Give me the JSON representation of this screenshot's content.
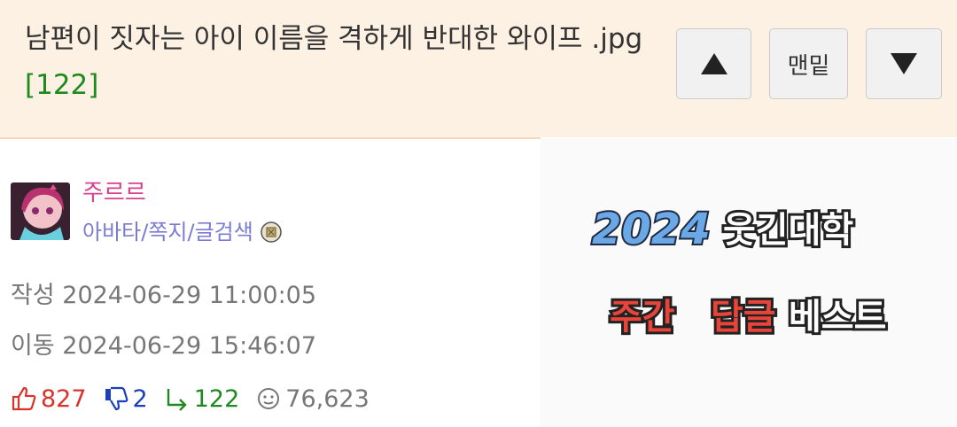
{
  "header": {
    "title": "남편이 짓자는 아이 이름을 격하게 반대한 와이프 .jpg",
    "reply_count": "[122]",
    "btn_up_icon": "triangle-up-icon",
    "btn_bottom_label": "맨밑",
    "btn_down_icon": "triangle-down-icon"
  },
  "author": {
    "nickname": "주르르",
    "links": "아바타/쪽지/글검색",
    "level_icon": "level-badge-icon"
  },
  "meta": {
    "created": "작성 2024-06-29 11:00:05",
    "moved": "이동 2024-06-29 15:46:07"
  },
  "stats": {
    "upvotes": "827",
    "downvotes": "2",
    "replies": "122",
    "views": "76,623"
  },
  "banner": {
    "year": "2024",
    "site": "웃긴대학",
    "word1": "주간",
    "word2": "답글",
    "word3": "베스트",
    "colors": {
      "year": "#6aa8e6",
      "accent": "#e8443a",
      "dark": "#2b2b2b"
    }
  }
}
